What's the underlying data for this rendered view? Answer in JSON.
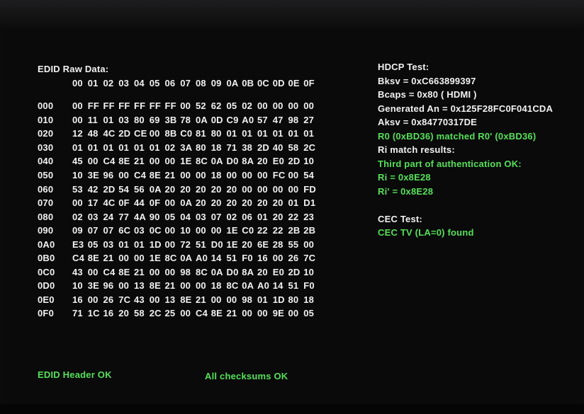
{
  "edid": {
    "title": "EDID Raw Data:",
    "columns": [
      "00",
      "01",
      "02",
      "03",
      "04",
      "05",
      "06",
      "07",
      "08",
      "09",
      "0A",
      "0B",
      "0C",
      "0D",
      "0E",
      "0F"
    ],
    "rows": [
      {
        "label": "000",
        "bytes": [
          "00",
          "FF",
          "FF",
          "FF",
          "FF",
          "FF",
          "FF",
          "00",
          "52",
          "62",
          "05",
          "02",
          "00",
          "00",
          "00",
          "00"
        ]
      },
      {
        "label": "010",
        "bytes": [
          "00",
          "11",
          "01",
          "03",
          "80",
          "69",
          "3B",
          "78",
          "0A",
          "0D",
          "C9",
          "A0",
          "57",
          "47",
          "98",
          "27"
        ]
      },
      {
        "label": "020",
        "bytes": [
          "12",
          "48",
          "4C",
          "2D",
          "CE",
          "00",
          "8B",
          "C0",
          "81",
          "80",
          "01",
          "01",
          "01",
          "01",
          "01",
          "01"
        ]
      },
      {
        "label": "030",
        "bytes": [
          "01",
          "01",
          "01",
          "01",
          "01",
          "01",
          "02",
          "3A",
          "80",
          "18",
          "71",
          "38",
          "2D",
          "40",
          "58",
          "2C"
        ]
      },
      {
        "label": "040",
        "bytes": [
          "45",
          "00",
          "C4",
          "8E",
          "21",
          "00",
          "00",
          "1E",
          "8C",
          "0A",
          "D0",
          "8A",
          "20",
          "E0",
          "2D",
          "10"
        ]
      },
      {
        "label": "050",
        "bytes": [
          "10",
          "3E",
          "96",
          "00",
          "C4",
          "8E",
          "21",
          "00",
          "00",
          "18",
          "00",
          "00",
          "00",
          "FC",
          "00",
          "54"
        ]
      },
      {
        "label": "060",
        "bytes": [
          "53",
          "42",
          "2D",
          "54",
          "56",
          "0A",
          "20",
          "20",
          "20",
          "20",
          "20",
          "00",
          "00",
          "00",
          "00",
          "FD"
        ]
      },
      {
        "label": "070",
        "bytes": [
          "00",
          "17",
          "4C",
          "0F",
          "44",
          "0F",
          "00",
          "0A",
          "20",
          "20",
          "20",
          "20",
          "20",
          "20",
          "01",
          "D1"
        ]
      },
      {
        "label": "080",
        "bytes": [
          "02",
          "03",
          "24",
          "77",
          "4A",
          "90",
          "05",
          "04",
          "03",
          "07",
          "02",
          "06",
          "01",
          "20",
          "22",
          "23"
        ]
      },
      {
        "label": "090",
        "bytes": [
          "09",
          "07",
          "07",
          "6C",
          "03",
          "0C",
          "00",
          "10",
          "00",
          "00",
          "1E",
          "C0",
          "22",
          "22",
          "2B",
          "2B"
        ]
      },
      {
        "label": "0A0",
        "bytes": [
          "E3",
          "05",
          "03",
          "01",
          "01",
          "1D",
          "00",
          "72",
          "51",
          "D0",
          "1E",
          "20",
          "6E",
          "28",
          "55",
          "00"
        ]
      },
      {
        "label": "0B0",
        "bytes": [
          "C4",
          "8E",
          "21",
          "00",
          "00",
          "1E",
          "8C",
          "0A",
          "A0",
          "14",
          "51",
          "F0",
          "16",
          "00",
          "26",
          "7C"
        ]
      },
      {
        "label": "0C0",
        "bytes": [
          "43",
          "00",
          "C4",
          "8E",
          "21",
          "00",
          "00",
          "98",
          "8C",
          "0A",
          "D0",
          "8A",
          "20",
          "E0",
          "2D",
          "10"
        ]
      },
      {
        "label": "0D0",
        "bytes": [
          "10",
          "3E",
          "96",
          "00",
          "13",
          "8E",
          "21",
          "00",
          "00",
          "18",
          "8C",
          "0A",
          "A0",
          "14",
          "51",
          "F0"
        ]
      },
      {
        "label": "0E0",
        "bytes": [
          "16",
          "00",
          "26",
          "7C",
          "43",
          "00",
          "13",
          "8E",
          "21",
          "00",
          "00",
          "98",
          "01",
          "1D",
          "80",
          "18"
        ]
      },
      {
        "label": "0F0",
        "bytes": [
          "71",
          "1C",
          "16",
          "20",
          "58",
          "2C",
          "25",
          "00",
          "C4",
          "8E",
          "21",
          "00",
          "00",
          "9E",
          "00",
          "05"
        ]
      }
    ],
    "header_status": "EDID Header OK",
    "checksum_status": "All checksums OK"
  },
  "hdcp": {
    "title": "HDCP Test:",
    "bksv": "Bksv = 0xC663899397",
    "bcaps": "Bcaps = 0x80 ( HDMI )",
    "generated_an": "Generated An = 0x125F28FC0F041CDA",
    "aksv": "Aksv = 0x84770317DE",
    "r0_result": "R0 (0xBD36) matched R0' (0xBD36)",
    "ri_title": "Ri match results:",
    "third_part": "Third part of authentication OK:",
    "ri": "Ri = 0x8E28",
    "ri_prime": "Ri' = 0x8E28"
  },
  "cec": {
    "title": "CEC Test:",
    "result": "CEC TV (LA=0) found"
  },
  "colors": {
    "text": "#f2f2f2",
    "ok_green": "#55e05a",
    "background": "#0a0a0a"
  }
}
